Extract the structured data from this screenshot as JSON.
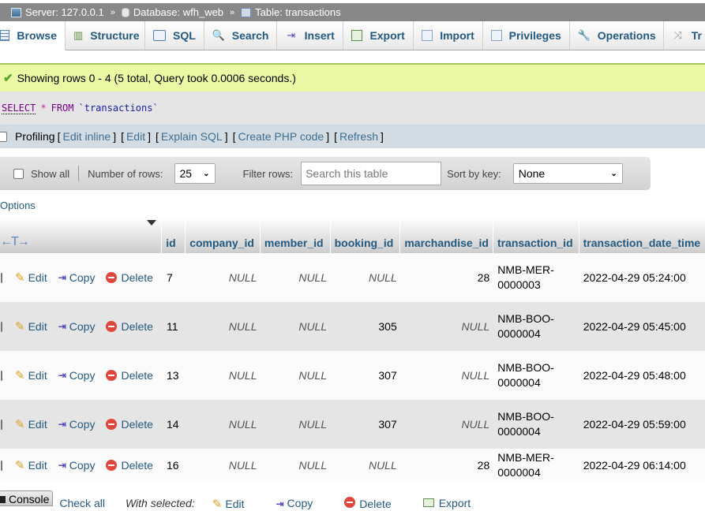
{
  "breadcrumb": {
    "server": "Server: 127.0.0.1",
    "database": "Database: wfh_web",
    "table": "Table: transactions",
    "separator": "»"
  },
  "tabs": [
    {
      "label": "Browse",
      "icon": "browse-icon",
      "active": true
    },
    {
      "label": "Structure",
      "icon": "structure-icon"
    },
    {
      "label": "SQL",
      "icon": "sql-icon"
    },
    {
      "label": "Search",
      "icon": "search-icon"
    },
    {
      "label": "Insert",
      "icon": "insert-icon"
    },
    {
      "label": "Export",
      "icon": "export-icon"
    },
    {
      "label": "Import",
      "icon": "import-icon"
    },
    {
      "label": "Privileges",
      "icon": "privileges-icon"
    },
    {
      "label": "Operations",
      "icon": "operations-icon"
    },
    {
      "label": "Tr",
      "icon": "triggers-icon"
    }
  ],
  "message": {
    "text": "Showing rows 0 - 4 (5 total, Query took 0.0006 seconds.)",
    "icon": "success-check-icon",
    "color": "#ebf8a4"
  },
  "sql": {
    "select": "SELECT",
    "star": "*",
    "from": "FROM",
    "table": "`transactions`"
  },
  "profiling": {
    "label": "Profiling",
    "links": [
      "Edit inline",
      "Edit",
      "Explain SQL",
      "Create PHP code",
      "Refresh"
    ]
  },
  "navbar": {
    "show_all": "Show all",
    "rows_label": "Number of rows:",
    "rows_value": "25",
    "filter_label": "Filter rows:",
    "filter_placeholder": "Search this table",
    "sort_label": "Sort by key:",
    "sort_value": "None"
  },
  "options_label": "Options",
  "table": {
    "columns": [
      "id",
      "company_id",
      "member_id",
      "booking_id",
      "marchandise_id",
      "transaction_id",
      "transaction_date_time"
    ],
    "actions": {
      "edit": "Edit",
      "copy": "Copy",
      "delete": "Delete"
    },
    "rows": [
      {
        "id": "7",
        "company_id": "NULL",
        "member_id": "NULL",
        "booking_id": "NULL",
        "marchandise_id": "28",
        "transaction_id_1": "NMB-MER-",
        "transaction_id_2": "0000003",
        "transaction_date_time": "2022-04-29 05:24:00"
      },
      {
        "id": "11",
        "company_id": "NULL",
        "member_id": "NULL",
        "booking_id": "305",
        "marchandise_id": "NULL",
        "transaction_id_1": "NMB-BOO-",
        "transaction_id_2": "0000004",
        "transaction_date_time": "2022-04-29 05:45:00"
      },
      {
        "id": "13",
        "company_id": "NULL",
        "member_id": "NULL",
        "booking_id": "307",
        "marchandise_id": "NULL",
        "transaction_id_1": "NMB-BOO-",
        "transaction_id_2": "0000004",
        "transaction_date_time": "2022-04-29 05:48:00"
      },
      {
        "id": "14",
        "company_id": "NULL",
        "member_id": "NULL",
        "booking_id": "307",
        "marchandise_id": "NULL",
        "transaction_id_1": "NMB-BOO-",
        "transaction_id_2": "0000004",
        "transaction_date_time": "2022-04-29 05:59:00"
      },
      {
        "id": "16",
        "company_id": "NULL",
        "member_id": "NULL",
        "booking_id": "NULL",
        "marchandise_id": "28",
        "transaction_id_1": "NMB-MER-",
        "transaction_id_2": "0000004",
        "transaction_date_time": "2022-04-29 06:14:00"
      }
    ]
  },
  "footer": {
    "console": "Console",
    "check_all": "Check all",
    "with_selected": "With selected:",
    "edit": "Edit",
    "copy": "Copy",
    "delete": "Delete",
    "export": "Export"
  }
}
